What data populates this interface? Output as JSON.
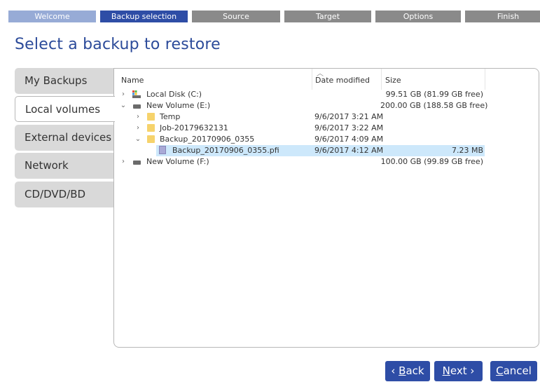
{
  "wizard": {
    "steps": [
      {
        "label": "Welcome",
        "state": "done"
      },
      {
        "label": "Backup selection",
        "state": "active"
      },
      {
        "label": "Source",
        "state": "todo"
      },
      {
        "label": "Target",
        "state": "todo"
      },
      {
        "label": "Options",
        "state": "todo"
      },
      {
        "label": "Finish",
        "state": "todo"
      }
    ]
  },
  "page": {
    "title": "Select a backup to restore"
  },
  "nav": {
    "items": [
      {
        "label": "My Backups"
      },
      {
        "label": "Local volumes",
        "selected": true
      },
      {
        "label": "External devices"
      },
      {
        "label": "Network"
      },
      {
        "label": "CD/DVD/BD"
      }
    ]
  },
  "browser": {
    "columns": {
      "name": "Name",
      "date": "Date modified",
      "size": "Size"
    },
    "rows": [
      {
        "name": "Local Disk (C:)",
        "date": "",
        "size": "99.51 GB (81.99 GB free)",
        "icon": "system-drive-icon",
        "expander": "collapsed",
        "level": 0
      },
      {
        "name": "New Volume (E:)",
        "date": "",
        "size": "200.00 GB (188.58 GB free)",
        "icon": "drive-icon",
        "expander": "expanded",
        "level": 0
      },
      {
        "name": "Temp",
        "date": "9/6/2017 3:21 AM",
        "size": "",
        "icon": "folder-icon",
        "expander": "collapsed",
        "level": 1
      },
      {
        "name": "Job-20179632131",
        "date": "9/6/2017 3:22 AM",
        "size": "",
        "icon": "folder-icon",
        "expander": "collapsed",
        "level": 1
      },
      {
        "name": "Backup_20170906_0355",
        "date": "9/6/2017 4:09 AM",
        "size": "",
        "icon": "folder-icon",
        "expander": "expanded",
        "level": 1
      },
      {
        "name": "Backup_20170906_0355.pfi",
        "date": "9/6/2017 4:12 AM",
        "size": "7.23 MB",
        "icon": "backup-file-icon",
        "expander": "none",
        "level": 2,
        "selected": true
      },
      {
        "name": "New Volume (F:)",
        "date": "",
        "size": "100.00 GB (99.89 GB free)",
        "icon": "drive-icon",
        "expander": "collapsed",
        "level": 0
      }
    ]
  },
  "buttons": {
    "back_arrow": "‹ ",
    "back_key": "B",
    "back_rest": "ack",
    "next_key": "N",
    "next_rest": "ext ›",
    "cancel_key": "C",
    "cancel_rest": "ancel"
  },
  "colors": {
    "accent": "#2e4da6",
    "step_done": "#97abd6",
    "step_todo": "#8a8a8a",
    "selection": "#cde8fb"
  }
}
